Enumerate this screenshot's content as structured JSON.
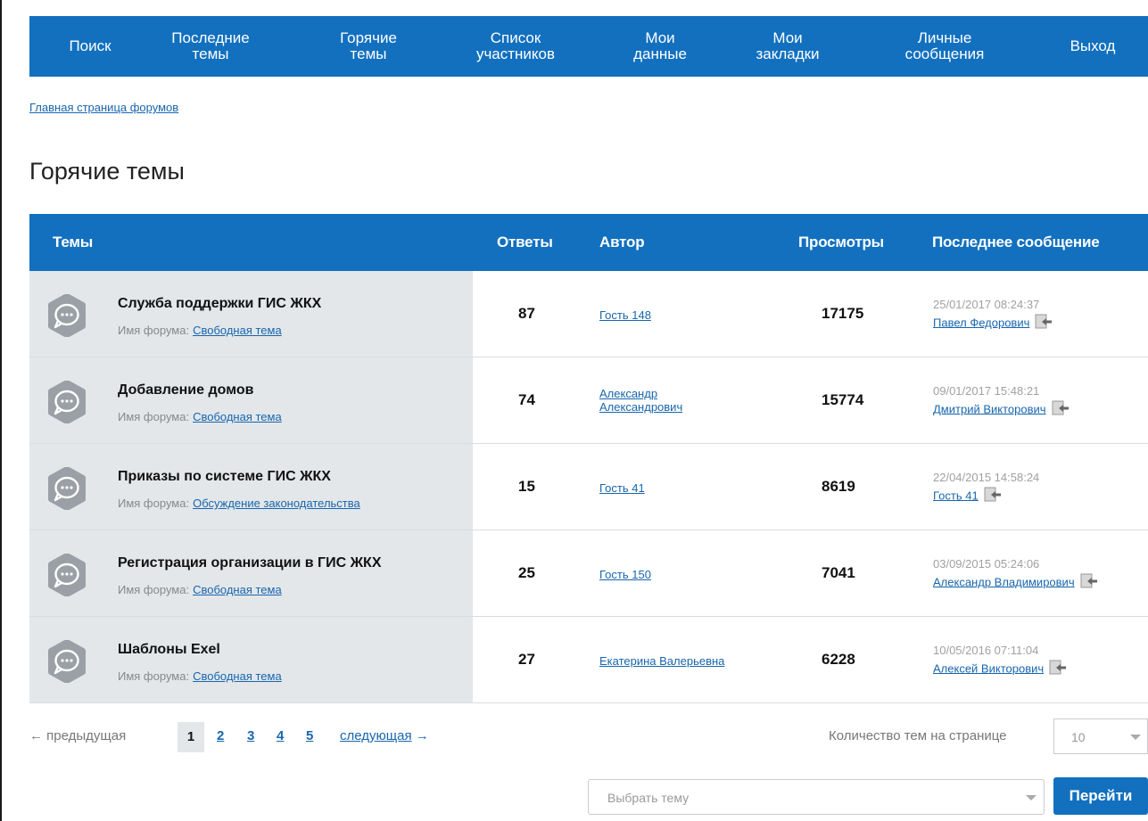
{
  "nav": {
    "items": [
      "Поиск",
      "Последние\nтемы",
      "Горячие\nтемы",
      "Список\nучастников",
      "Мои\nданные",
      "Мои\nзакладки",
      "Личные\nсообщения",
      "Выход"
    ]
  },
  "breadcrumb": "Главная страница форумов",
  "page_title": "Горячие темы",
  "table": {
    "headers": {
      "topics": "Темы",
      "replies": "Ответы",
      "author": "Автор",
      "views": "Просмотры",
      "last_message": "Последнее сообщение"
    },
    "forum_label": "Имя форума:",
    "rows": [
      {
        "title": "Служба поддержки ГИС ЖКХ",
        "forum": "Свободная тема",
        "replies": "87",
        "author": "Гость 148",
        "views": "17175",
        "last_date": "25/01/2017 08:24:37",
        "last_user": "Павел Федорович"
      },
      {
        "title": "Добавление домов",
        "forum": "Свободная тема",
        "replies": "74",
        "author": "Александр\nАлександрович",
        "views": "15774",
        "last_date": "09/01/2017 15:48:21",
        "last_user": "Дмитрий Викторович"
      },
      {
        "title": "Приказы по системе ГИС ЖКХ",
        "forum": "Обсуждение законодательства",
        "replies": "15",
        "author": "Гость 41",
        "views": "8619",
        "last_date": "22/04/2015 14:58:24",
        "last_user": "Гость 41"
      },
      {
        "title": "Регистрация организации в ГИС ЖКХ",
        "forum": "Свободная тема",
        "replies": "25",
        "author": "Гость 150",
        "views": "7041",
        "last_date": "03/09/2015 05:24:06",
        "last_user": "Александр Владимирович"
      },
      {
        "title": "Шаблоны Exel",
        "forum": "Свободная тема",
        "replies": "27",
        "author": "Екатерина Валерьевна",
        "views": "6228",
        "last_date": "10/05/2016 07:11:04",
        "last_user": "Алексей Викторович"
      }
    ]
  },
  "pagination": {
    "prev": "← предыдущая",
    "pages": [
      "1",
      "2",
      "3",
      "4",
      "5"
    ],
    "current": "1",
    "next": "следующая",
    "next_arrow": "→"
  },
  "per_page": {
    "label": "Количество тем на странице",
    "value": "10"
  },
  "topic_select": {
    "placeholder": "Выбрать тему"
  },
  "go_button": "Перейти",
  "colors": {
    "primary": "#1270bf",
    "link": "#1866ad",
    "row_bg": "#e3e7ea"
  },
  "icons": {
    "topic": "chat-bubble-icon",
    "last_post": "go-to-post-icon"
  }
}
